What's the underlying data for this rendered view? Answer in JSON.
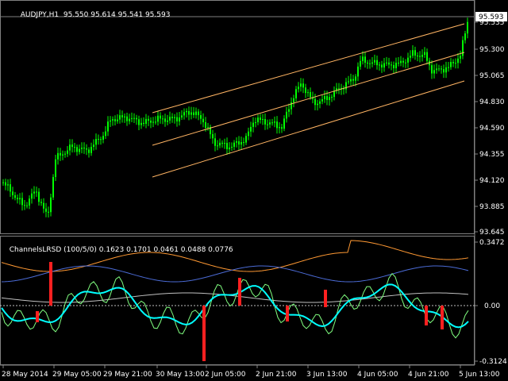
{
  "main_header": {
    "symbol_label": "AUDJPY,H1",
    "ohlc": "95.550 95.614 95.541 95.593"
  },
  "price_axis": {
    "ticks": [
      "95.535",
      "95.300",
      "95.065",
      "94.830",
      "94.590",
      "94.355",
      "94.120",
      "93.885",
      "93.645"
    ],
    "current_price": "95.593"
  },
  "indicator_header": {
    "name": "ChannelsLRSD (100/5/0)",
    "values": "0.1623 0.1701 0.0461 0.0488 0.0776"
  },
  "indicator_axis": {
    "ticks": [
      "0.3472",
      "0.00",
      "-0.3124"
    ]
  },
  "time_axis": {
    "ticks": [
      "28 May 2014",
      "29 May 05:00",
      "29 May 21:00",
      "30 May 13:00",
      "2 Jun 05:00",
      "2 Jun 21:00",
      "3 Jun 13:00",
      "4 Jun 05:00",
      "4 Jun 21:00",
      "5 Jun 13:00"
    ]
  },
  "colors": {
    "background": "#000000",
    "candles": "#00ff00",
    "channel_lines": "#ffb463",
    "oscillator_main": "#00ffff",
    "signal_line": "#80ff80",
    "histogram": "#ff2020",
    "band_upper": "#ff9933",
    "band_blue": "#4b6bd6",
    "text": "#ffffff"
  }
}
